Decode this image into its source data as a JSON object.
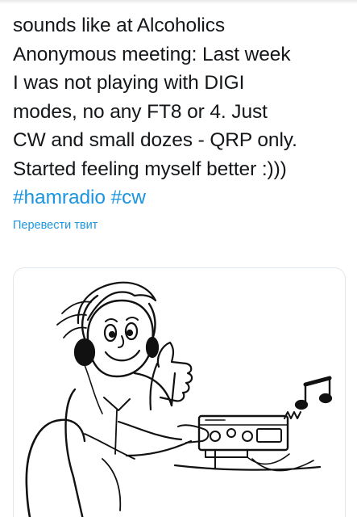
{
  "tweet": {
    "lines": [
      "sounds like at Alcoholics",
      "Anonymous meeting: Last week",
      "I was not playing with DIGI",
      "modes, no any FT8 or 4. Just",
      "CW and small dozes - QRP only.",
      "Started feeling myself better :)))"
    ],
    "hashtags": [
      "#hamradio",
      "#cw"
    ]
  },
  "translate_link": "Перевести твит",
  "media": {
    "icon": "cartoon-ham-radio-operator-image"
  },
  "colors": {
    "text": "#14171a",
    "link": "#1b95e0",
    "card_border": "#e1e8ed"
  }
}
